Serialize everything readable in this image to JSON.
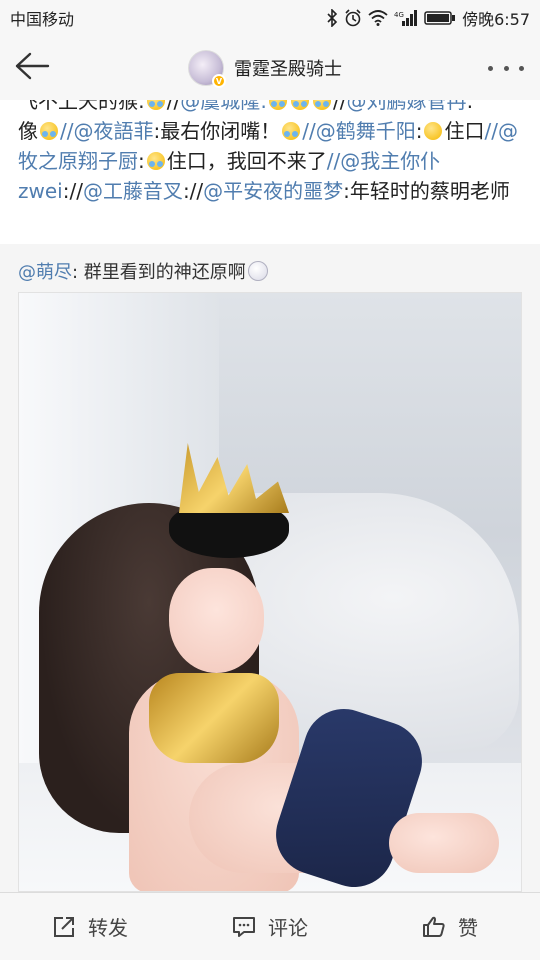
{
  "status_bar": {
    "carrier": "中国移动",
    "time": "傍晚6:57",
    "icons": [
      "bluetooth-icon",
      "alarm-icon",
      "wifi-icon",
      "signal-icon",
      "battery-icon"
    ],
    "network_label": "4G"
  },
  "nav": {
    "title": "雷霆圣殿骑士",
    "back_icon": "back-arrow-icon",
    "more_icon": "more-dots-icon",
    "verified_badge": "V"
  },
  "repost": {
    "line0": {
      "text_a": "飞不上天的猴:",
      "text_b": "//",
      "mention_1": "@虞城隆:",
      "text_c": "//",
      "mention_2": "@刘鹏嫁管冉",
      "text_d": ":"
    },
    "segments": [
      {
        "type": "text",
        "value": "像"
      },
      {
        "type": "mention",
        "value": "//@夜語菲"
      },
      {
        "type": "text",
        "value": ":最右你闭嘴！"
      },
      {
        "type": "mention",
        "value": "//@鹤舞千阳"
      },
      {
        "type": "text",
        "value": ":"
      },
      {
        "type": "text",
        "value": "住口"
      },
      {
        "type": "mention",
        "value": "//@牧之原翔子厨"
      },
      {
        "type": "text",
        "value": ":"
      },
      {
        "type": "text",
        "value": "住口，我回不来了"
      },
      {
        "type": "mention",
        "value": "//@我主你仆zwei"
      },
      {
        "type": "text",
        "value": "://"
      },
      {
        "type": "mention",
        "value": "@工藤音叉"
      },
      {
        "type": "text",
        "value": "://"
      },
      {
        "type": "mention",
        "value": "@平安夜的噩梦"
      },
      {
        "type": "text",
        "value": ":年轻时的蔡明老师"
      }
    ]
  },
  "original": {
    "mention": "@萌尽",
    "text": ": 群里看到的神还原啊"
  },
  "toolbar": {
    "repost_label": "转发",
    "comment_label": "评论",
    "like_label": "赞"
  },
  "colors": {
    "mention": "#507daf",
    "bar_bg": "#f7f7f7"
  }
}
